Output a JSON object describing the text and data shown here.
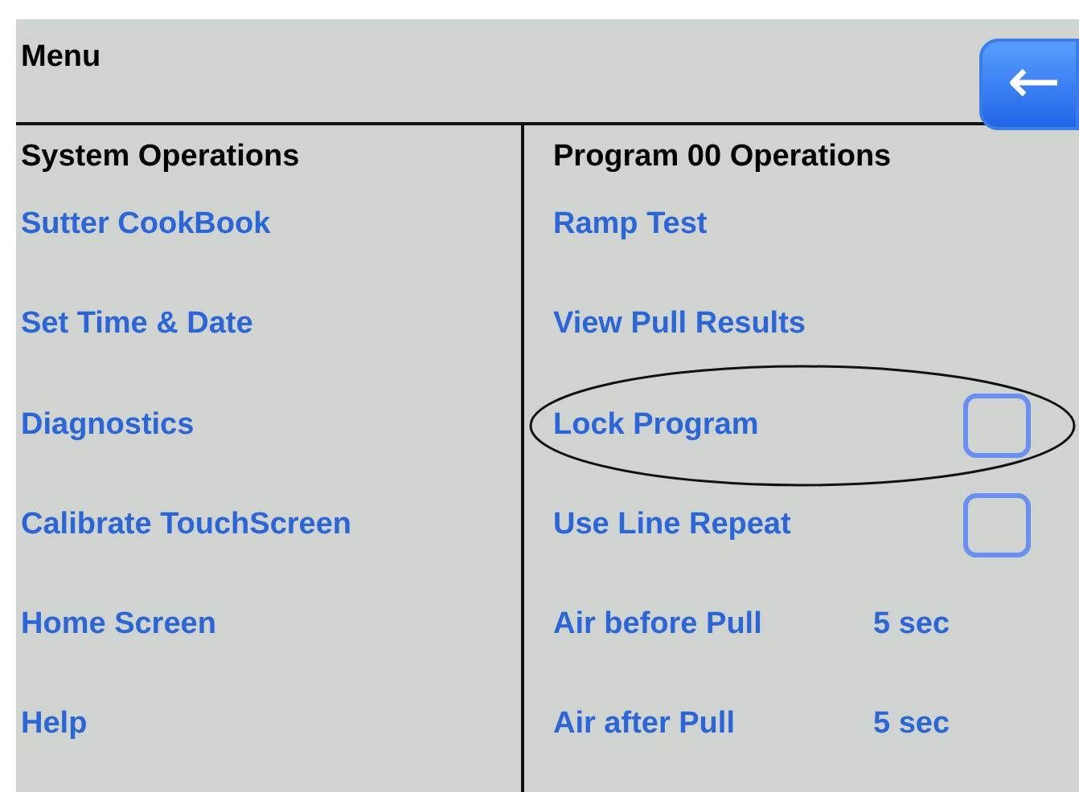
{
  "header": {
    "title": "Menu",
    "back_button": "←"
  },
  "system_operations": {
    "heading": "System Operations",
    "items": [
      {
        "label": "Sutter CookBook"
      },
      {
        "label": "Set Time & Date"
      },
      {
        "label": "Diagnostics"
      },
      {
        "label": "Calibrate TouchScreen"
      },
      {
        "label": "Home Screen"
      },
      {
        "label": "Help"
      }
    ]
  },
  "program_operations": {
    "heading": "Program 00 Operations",
    "items": [
      {
        "kind": "link",
        "label": "Ramp Test",
        "highlighted": false
      },
      {
        "kind": "link",
        "label": "View Pull Results",
        "highlighted": false
      },
      {
        "kind": "checkbox",
        "label": "Lock Program",
        "checked": false,
        "highlighted": true
      },
      {
        "kind": "checkbox",
        "label": "Use Line Repeat",
        "checked": false,
        "highlighted": false
      },
      {
        "kind": "value",
        "label": "Air before Pull",
        "value": "5 sec",
        "highlighted": false
      },
      {
        "kind": "value",
        "label": "Air after Pull",
        "value": "5 sec",
        "highlighted": false
      }
    ]
  }
}
